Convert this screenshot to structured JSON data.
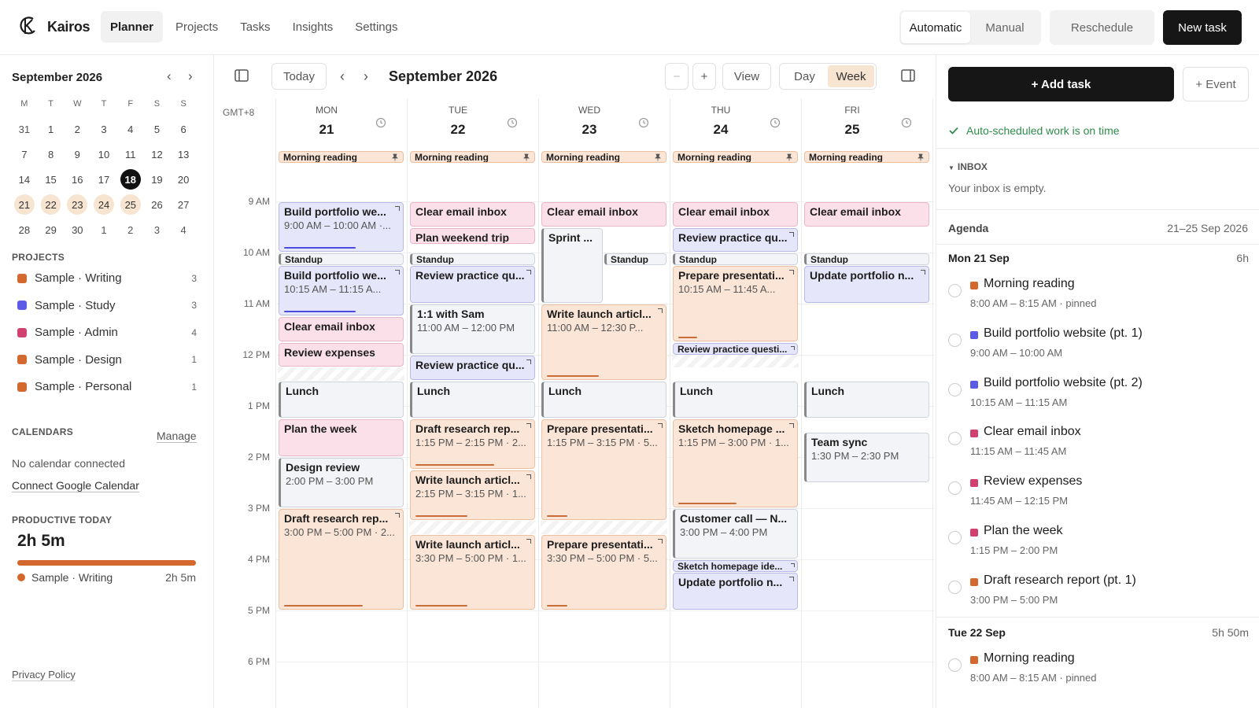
{
  "app": {
    "name": "Kairos"
  },
  "nav": [
    "Planner",
    "Projects",
    "Tasks",
    "Insights",
    "Settings"
  ],
  "header": {
    "mode_auto": "Automatic",
    "mode_manual": "Manual",
    "reschedule": "Reschedule",
    "new_task": "New task"
  },
  "mini": {
    "title": "September 2026",
    "prev": "‹",
    "next": "›",
    "weekdays": [
      "M",
      "T",
      "W",
      "T",
      "F",
      "S",
      "S"
    ],
    "rows": [
      [
        "31",
        "1",
        "2",
        "3",
        "4",
        "5",
        "6"
      ],
      [
        "7",
        "8",
        "9",
        "10",
        "11",
        "12",
        "13"
      ],
      [
        "14",
        "15",
        "16",
        "17",
        "18",
        "19",
        "20"
      ],
      [
        "21",
        "22",
        "23",
        "24",
        "25",
        "26",
        "27"
      ],
      [
        "28",
        "29",
        "30",
        "1",
        "2",
        "3",
        "4"
      ]
    ]
  },
  "projects": {
    "heading": "PROJECTS",
    "items": [
      {
        "name": "Sample · Writing",
        "count": "3",
        "color": "#d4692f"
      },
      {
        "name": "Sample · Study",
        "count": "3",
        "color": "#5b5be6"
      },
      {
        "name": "Sample · Admin",
        "count": "4",
        "color": "#d0416f"
      },
      {
        "name": "Sample · Design",
        "count": "1",
        "color": "#d4692f"
      },
      {
        "name": "Sample · Personal",
        "count": "1",
        "color": "#d4692f"
      }
    ]
  },
  "calendars": {
    "heading": "CALENDARS",
    "manage": "Manage",
    "none": "No calendar connected",
    "connect": "Connect Google Calendar"
  },
  "productive": {
    "heading": "PRODUCTIVE TODAY",
    "value": "2h 5m",
    "fill_fraction": 1,
    "project": "Sample · Writing",
    "project_value": "2h 5m"
  },
  "privacy": "Privacy Policy",
  "toolbar": {
    "today": "Today",
    "prev": "‹",
    "next": "›",
    "title": "September 2026",
    "zoom_out": "−",
    "zoom_in": "+",
    "view": "View",
    "day": "Day",
    "week": "Week"
  },
  "calendar": {
    "timezone": "GMT+8",
    "days": [
      {
        "name": "MON",
        "date": "21"
      },
      {
        "name": "TUE",
        "date": "22"
      },
      {
        "name": "WED",
        "date": "23"
      },
      {
        "name": "THU",
        "date": "24"
      },
      {
        "name": "FRI",
        "date": "25"
      }
    ],
    "hours": [
      "9 AM",
      "10 AM",
      "11 AM",
      "12 PM",
      "1 PM",
      "2 PM",
      "3 PM",
      "4 PM",
      "5 PM",
      "6 PM"
    ],
    "events": [
      {
        "day": 0,
        "title": "Morning reading",
        "kind": "tiny",
        "color": "or",
        "start": "8:00",
        "end": "8:15",
        "pinned": true
      },
      {
        "day": 1,
        "title": "Morning reading",
        "kind": "tiny",
        "color": "or",
        "start": "8:00",
        "end": "8:15",
        "pinned": true
      },
      {
        "day": 2,
        "title": "Morning reading",
        "kind": "tiny",
        "color": "or",
        "start": "8:00",
        "end": "8:15",
        "pinned": true
      },
      {
        "day": 3,
        "title": "Morning reading",
        "kind": "tiny",
        "color": "or",
        "start": "8:00",
        "end": "8:15",
        "pinned": true
      },
      {
        "day": 4,
        "title": "Morning reading",
        "kind": "tiny",
        "color": "or",
        "start": "8:00",
        "end": "8:15",
        "pinned": true
      },
      {
        "day": 0,
        "title": "Build portfolio we...",
        "sub": "9:00 AM – 10:00 AM ·...",
        "color": "pu",
        "start": "9:00",
        "end": "10:00",
        "progress": 0.62,
        "corner": true
      },
      {
        "day": 0,
        "title": "Standup",
        "kind": "tiny",
        "color": "gr",
        "start": "10:00",
        "end": "10:15"
      },
      {
        "day": 0,
        "title": "Build portfolio we...",
        "sub": "10:15 AM – 11:15 A...",
        "color": "pu",
        "start": "10:15",
        "end": "11:15",
        "progress": 0.62,
        "corner": true
      },
      {
        "day": 0,
        "title": "Clear email inbox",
        "color": "pk",
        "start": "11:15",
        "end": "11:45"
      },
      {
        "day": 0,
        "title": "Review expenses",
        "color": "pk",
        "start": "11:45",
        "end": "12:15"
      },
      {
        "day": 0,
        "title": "Lunch",
        "color": "gr",
        "start": "12:30",
        "end": "13:15"
      },
      {
        "day": 0,
        "title": "Plan the week",
        "color": "pk",
        "start": "13:15",
        "end": "14:00"
      },
      {
        "day": 0,
        "title": "Design review",
        "sub": "2:00 PM – 3:00 PM",
        "color": "gr",
        "start": "14:00",
        "end": "15:00"
      },
      {
        "day": 0,
        "title": "Draft research rep...",
        "sub": "3:00 PM – 5:00 PM · 2...",
        "color": "or",
        "start": "15:00",
        "end": "17:00",
        "progress": 0.68,
        "corner": true
      },
      {
        "day": 1,
        "title": "Clear email inbox",
        "color": "pk",
        "start": "9:00",
        "end": "9:30"
      },
      {
        "day": 1,
        "title": "Plan weekend trip",
        "color": "pk",
        "start": "9:30",
        "end": "9:50"
      },
      {
        "day": 1,
        "title": "Standup",
        "kind": "tiny",
        "color": "gr",
        "start": "10:00",
        "end": "10:15"
      },
      {
        "day": 1,
        "title": "Review practice qu...",
        "color": "pu",
        "start": "10:15",
        "end": "11:00",
        "corner": true
      },
      {
        "day": 1,
        "title": "1:1 with Sam",
        "sub": "11:00 AM – 12:00 PM",
        "color": "gr",
        "start": "11:00",
        "end": "12:00"
      },
      {
        "day": 1,
        "title": "Review practice qu...",
        "color": "pu",
        "start": "12:00",
        "end": "12:30",
        "corner": true
      },
      {
        "day": 1,
        "title": "Lunch",
        "color": "gr",
        "start": "12:30",
        "end": "13:15"
      },
      {
        "day": 1,
        "title": "Draft research rep...",
        "sub": "1:15 PM – 2:15 PM · 2...",
        "color": "or",
        "start": "13:15",
        "end": "14:15",
        "progress": 0.68,
        "corner": true
      },
      {
        "day": 1,
        "title": "Write launch articl...",
        "sub": "2:15 PM – 3:15 PM · 1...",
        "color": "or",
        "start": "14:15",
        "end": "15:15",
        "progress": 0.45,
        "corner": true
      },
      {
        "day": 1,
        "title": "Write launch articl...",
        "sub": "3:30 PM – 5:00 PM · 1...",
        "color": "or",
        "start": "15:30",
        "end": "17:00",
        "progress": 0.45,
        "corner": true
      },
      {
        "day": 2,
        "title": "Clear email inbox",
        "color": "pk",
        "start": "9:00",
        "end": "9:30"
      },
      {
        "day": 2,
        "title": "Sprint ...",
        "color": "gr",
        "start": "9:30",
        "end": "11:00",
        "half": "left"
      },
      {
        "day": 2,
        "title": "Standup",
        "kind": "tiny",
        "color": "gr",
        "start": "10:00",
        "end": "10:15",
        "half": "right"
      },
      {
        "day": 2,
        "title": "Write launch articl...",
        "sub": "11:00 AM – 12:30 P...",
        "color": "or",
        "start": "11:00",
        "end": "12:30",
        "progress": 0.45,
        "corner": true
      },
      {
        "day": 2,
        "title": "Lunch",
        "color": "gr",
        "start": "12:30",
        "end": "13:15"
      },
      {
        "day": 2,
        "title": "Prepare presentati...",
        "sub": "1:15 PM – 3:15 PM · 5...",
        "color": "or",
        "start": "13:15",
        "end": "15:15",
        "progress": 0.18,
        "corner": true
      },
      {
        "day": 2,
        "title": "Prepare presentati...",
        "sub": "3:30 PM – 5:00 PM · 5...",
        "color": "or",
        "start": "15:30",
        "end": "17:00",
        "progress": 0.18,
        "corner": true
      },
      {
        "day": 3,
        "title": "Clear email inbox",
        "color": "pk",
        "start": "9:00",
        "end": "9:30"
      },
      {
        "day": 3,
        "title": "Review practice qu...",
        "color": "pu",
        "start": "9:30",
        "end": "10:00",
        "corner": true
      },
      {
        "day": 3,
        "title": "Standup",
        "kind": "tiny",
        "color": "gr",
        "start": "10:00",
        "end": "10:15"
      },
      {
        "day": 3,
        "title": "Prepare presentati...",
        "sub": "10:15 AM – 11:45 A...",
        "color": "or",
        "start": "10:15",
        "end": "11:45",
        "progress": 0.16,
        "corner": true
      },
      {
        "day": 3,
        "title": "Review practice questi...",
        "kind": "tiny",
        "color": "pu",
        "start": "11:45",
        "end": "12:00",
        "corner": true
      },
      {
        "day": 3,
        "title": "Lunch",
        "color": "gr",
        "start": "12:30",
        "end": "13:15"
      },
      {
        "day": 3,
        "title": "Sketch homepage ...",
        "sub": "1:15 PM – 3:00 PM · 1...",
        "color": "or",
        "start": "13:15",
        "end": "15:00",
        "progress": 0.5,
        "corner": true
      },
      {
        "day": 3,
        "title": "Customer call — N...",
        "sub": "3:00 PM – 4:00 PM",
        "color": "gr",
        "start": "15:00",
        "end": "16:00"
      },
      {
        "day": 3,
        "title": "Sketch homepage ide...",
        "kind": "tiny",
        "color": "pu",
        "start": "16:00",
        "end": "16:15",
        "corner": true
      },
      {
        "day": 3,
        "title": "Update portfolio n...",
        "color": "pu",
        "start": "16:15",
        "end": "17:00",
        "corner": true
      },
      {
        "day": 4,
        "title": "Clear email inbox",
        "color": "pk",
        "start": "9:00",
        "end": "9:30"
      },
      {
        "day": 4,
        "title": "Standup",
        "kind": "tiny",
        "color": "gr",
        "start": "10:00",
        "end": "10:15"
      },
      {
        "day": 4,
        "title": "Update portfolio n...",
        "color": "pu",
        "start": "10:15",
        "end": "11:00",
        "corner": true
      },
      {
        "day": 4,
        "title": "Lunch",
        "color": "gr",
        "start": "12:30",
        "end": "13:15"
      },
      {
        "day": 4,
        "title": "Team sync",
        "sub": "1:30 PM – 2:30 PM",
        "color": "gr",
        "start": "13:30",
        "end": "14:30"
      }
    ],
    "hatches": [
      {
        "day": 0,
        "start": "12:15",
        "end": "12:30"
      },
      {
        "day": 3,
        "start": "12:00",
        "end": "12:15"
      },
      {
        "day": 1,
        "start": "15:15",
        "end": "15:30"
      },
      {
        "day": 2,
        "start": "15:15",
        "end": "15:30"
      }
    ]
  },
  "right": {
    "add_task": "+ Add task",
    "add_event": "+ Event",
    "on_time": "Auto-scheduled work is on time",
    "inbox_heading": "INBOX",
    "inbox_empty": "Your inbox is empty.",
    "agenda": "Agenda",
    "agenda_range": "21–25 Sep 2026",
    "days": [
      {
        "label": "Mon 21 Sep",
        "hours": "6h",
        "items": [
          {
            "name": "Morning reading",
            "time": "8:00 AM – 8:15 AM · pinned",
            "color": "#d4692f"
          },
          {
            "name": "Build portfolio website (pt. 1)",
            "time": "9:00 AM – 10:00 AM",
            "color": "#5b5be6"
          },
          {
            "name": "Build portfolio website (pt. 2)",
            "time": "10:15 AM – 11:15 AM",
            "color": "#5b5be6"
          },
          {
            "name": "Clear email inbox",
            "time": "11:15 AM – 11:45 AM",
            "color": "#d0416f"
          },
          {
            "name": "Review expenses",
            "time": "11:45 AM – 12:15 PM",
            "color": "#d0416f"
          },
          {
            "name": "Plan the week",
            "time": "1:15 PM – 2:00 PM",
            "color": "#d0416f"
          },
          {
            "name": "Draft research report (pt. 1)",
            "time": "3:00 PM – 5:00 PM",
            "color": "#d4692f"
          }
        ]
      },
      {
        "label": "Tue 22 Sep",
        "hours": "5h 50m",
        "items": [
          {
            "name": "Morning reading",
            "time": "8:00 AM – 8:15 AM · pinned",
            "color": "#d4692f"
          }
        ]
      }
    ]
  }
}
